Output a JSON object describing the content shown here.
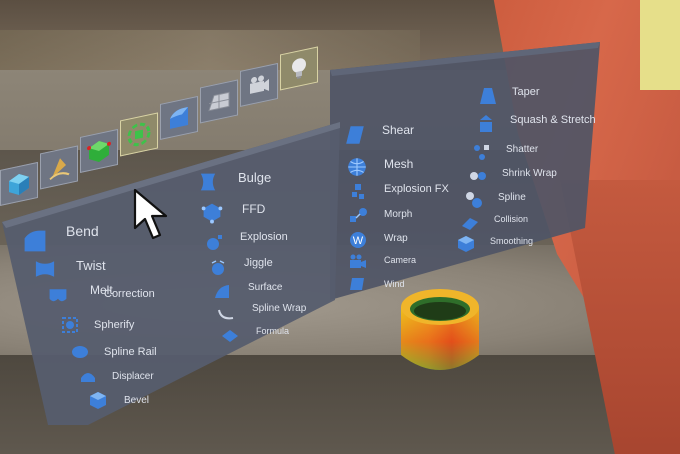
{
  "toolbar": {
    "buttons": [
      {
        "icon": "cube-icon"
      },
      {
        "icon": "pen-tool-icon"
      },
      {
        "icon": "green-cube-icon"
      },
      {
        "icon": "generator-icon"
      },
      {
        "icon": "deformer-icon"
      },
      {
        "icon": "floor-icon"
      },
      {
        "icon": "camera-icon"
      },
      {
        "icon": "light-icon"
      }
    ]
  },
  "deformers": {
    "col1": [
      {
        "label": "Bend",
        "icon": "bend-icon"
      },
      {
        "label": "Twist",
        "icon": "twist-icon"
      },
      {
        "label": "Melt",
        "icon": "melt-icon"
      },
      {
        "label": "Correction",
        "icon": "correction-icon"
      },
      {
        "label": "Spherify",
        "icon": "spherify-icon"
      },
      {
        "label": "Spline Rail",
        "icon": "spline-rail-icon"
      },
      {
        "label": "Displacer",
        "icon": "displacer-icon"
      },
      {
        "label": "Bevel",
        "icon": "bevel-icon"
      }
    ],
    "col2": [
      {
        "label": "Bulge",
        "icon": "bulge-icon"
      },
      {
        "label": "FFD",
        "icon": "ffd-icon"
      },
      {
        "label": "Explosion",
        "icon": "explosion-icon"
      },
      {
        "label": "Jiggle",
        "icon": "jiggle-icon"
      },
      {
        "label": "Surface",
        "icon": "surface-icon"
      },
      {
        "label": "Spline Wrap",
        "icon": "spline-wrap-icon"
      },
      {
        "label": "Formula",
        "icon": "formula-icon"
      }
    ],
    "col3": [
      {
        "label": "Shear",
        "icon": "shear-icon"
      },
      {
        "label": "Mesh",
        "icon": "mesh-icon"
      },
      {
        "label": "Explosion FX",
        "icon": "explosion-fx-icon"
      },
      {
        "label": "Morph",
        "icon": "morph-icon"
      },
      {
        "label": "Wrap",
        "icon": "wrap-icon"
      },
      {
        "label": "Camera",
        "icon": "camera-icon"
      },
      {
        "label": "Wind",
        "icon": "wind-icon"
      }
    ],
    "col4": [
      {
        "label": "Taper",
        "icon": "taper-icon"
      },
      {
        "label": "Squash & Stretch",
        "icon": "squash-stretch-icon"
      },
      {
        "label": "Shatter",
        "icon": "shatter-icon"
      },
      {
        "label": "Shrink Wrap",
        "icon": "shrink-wrap-icon"
      },
      {
        "label": "Spline",
        "icon": "spline-icon"
      },
      {
        "label": "Collision",
        "icon": "collision-icon"
      },
      {
        "label": "Smoothing",
        "icon": "smoothing-icon"
      }
    ]
  },
  "colors": {
    "panel": "#4e5464",
    "icon_blue": "#3d7fd9",
    "label": "#dfe3ec"
  }
}
